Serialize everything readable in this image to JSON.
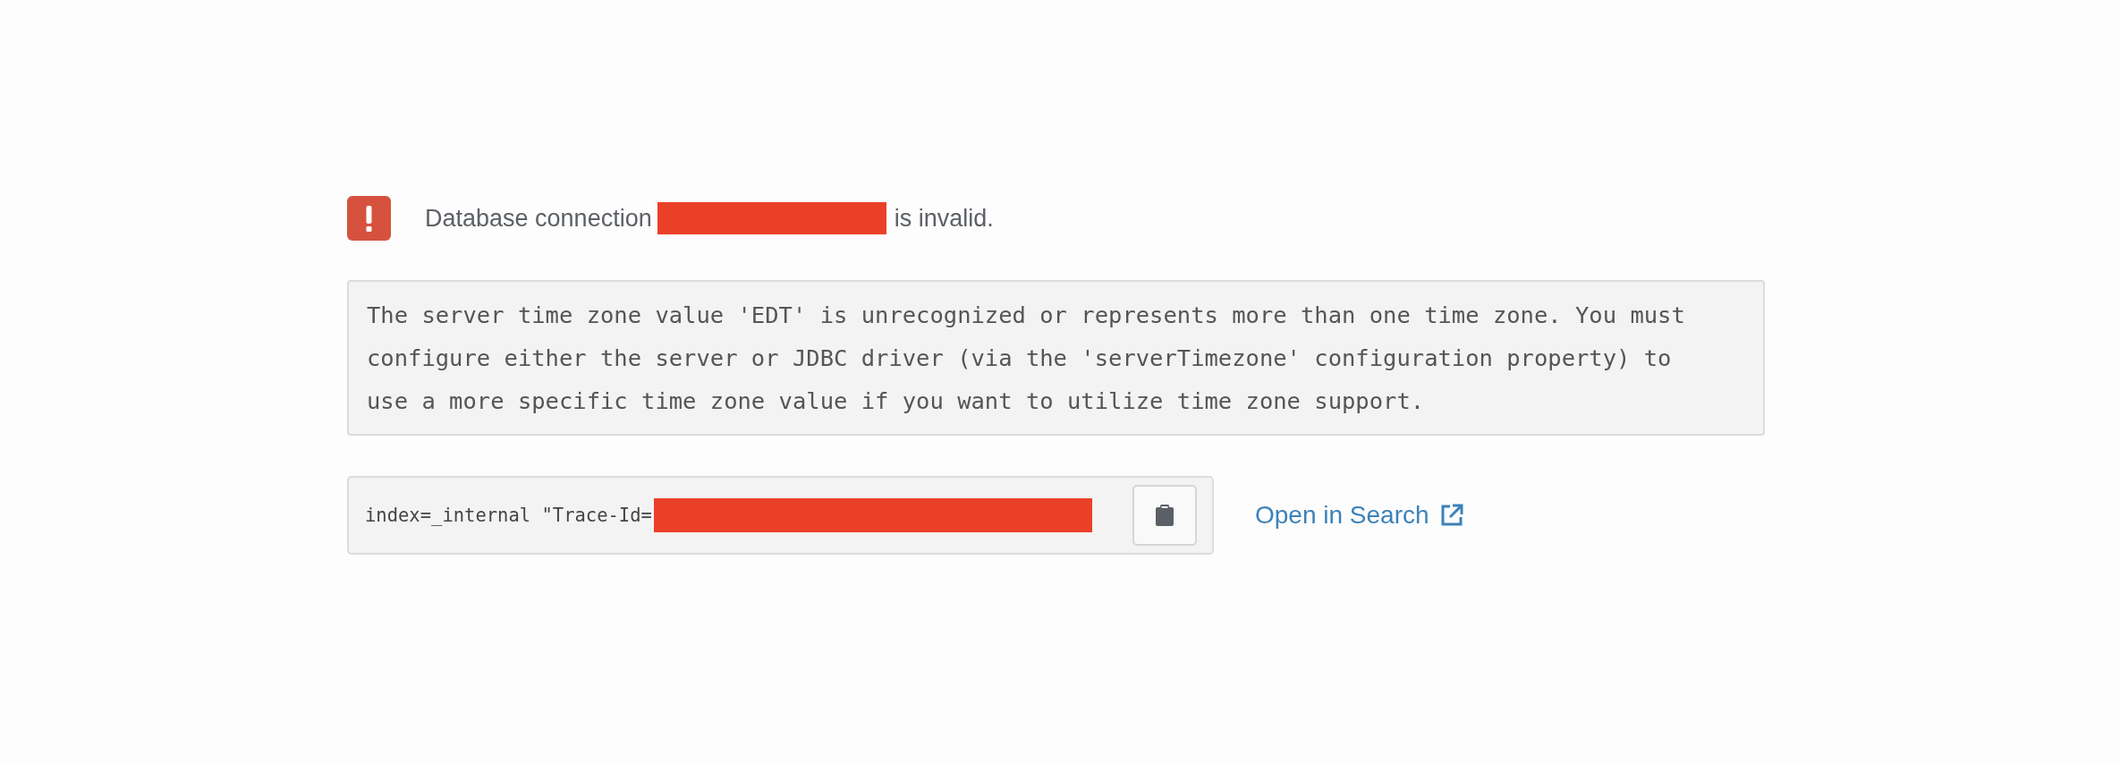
{
  "error": {
    "before": "Database connection",
    "redacted": true,
    "after": "is invalid."
  },
  "message": "The server time zone value 'EDT' is unrecognized or represents more than one time zone. You must configure either the server or JDBC driver (via the 'serverTimezone' configuration property) to use a more specific time zone value if you want to utilize time zone support.",
  "query": {
    "text": "index=_internal \"Trace-Id=",
    "redacted": true
  },
  "link": {
    "label": "Open in Search"
  }
}
